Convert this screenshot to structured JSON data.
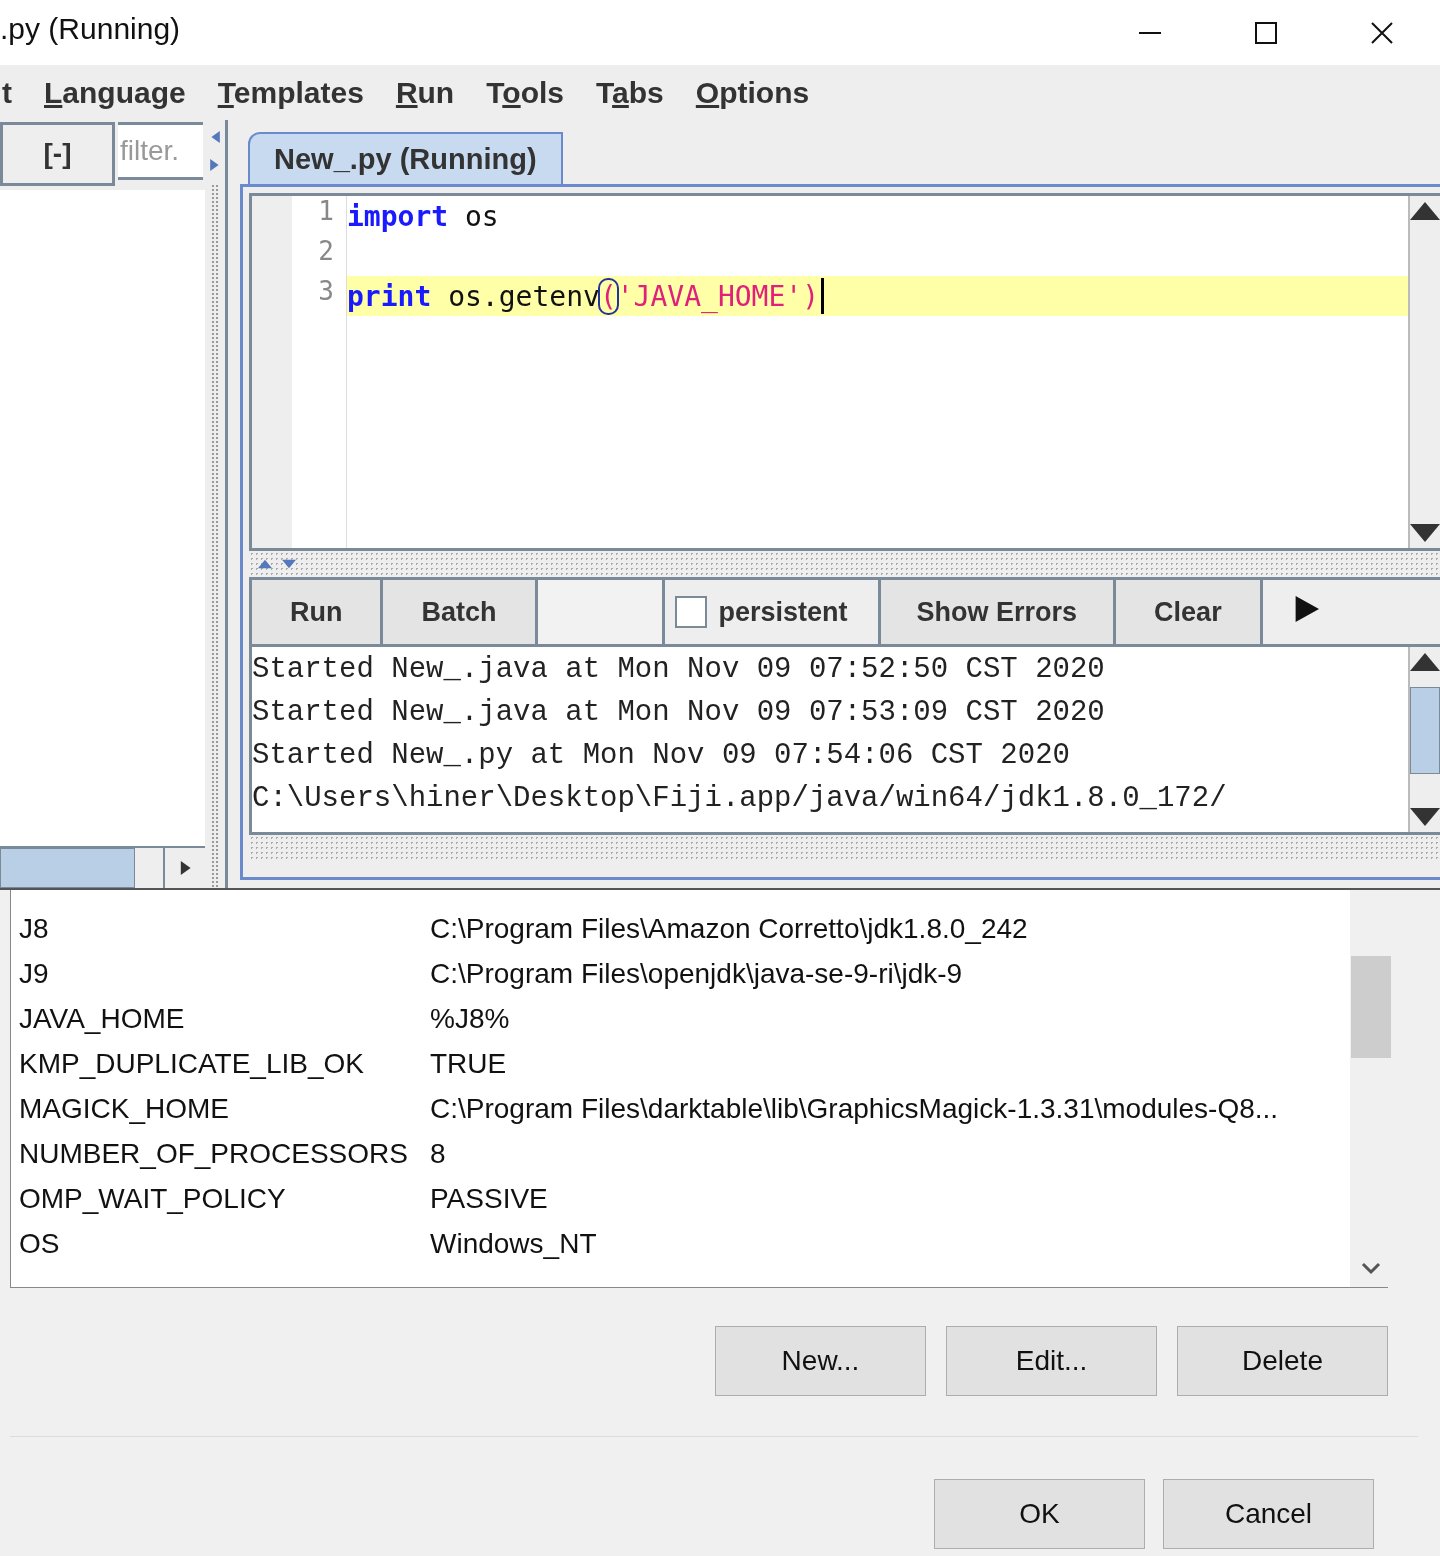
{
  "window": {
    "title": ".py (Running)"
  },
  "menu": [
    {
      "pre": "t"
    },
    {
      "key": "L",
      "post": "anguage"
    },
    {
      "key": "T",
      "post": "emplates"
    },
    {
      "key": "R",
      "post": "un"
    },
    {
      "pre": "T",
      "key": "o",
      "post": "ols"
    },
    {
      "pre": "T",
      "key": "a",
      "post": "bs"
    },
    {
      "key": "O",
      "post": "ptions"
    }
  ],
  "sidebar": {
    "collapse_button": "[-]",
    "filter": {
      "placeholder": "filter."
    }
  },
  "editor": {
    "tab": {
      "label": "New_.py (Running)",
      "selected": true
    },
    "lines": [
      {
        "number": "1",
        "current": false,
        "tokens": [
          {
            "text": "import",
            "kind": "keyword"
          },
          {
            "text": " os",
            "kind": "plain"
          }
        ]
      },
      {
        "number": "2",
        "current": false
      },
      {
        "number": "3",
        "current": true,
        "tokens": [
          {
            "text": "print",
            "kind": "keyword"
          },
          {
            "text": " os.getenv",
            "kind": "plain"
          },
          {
            "text": "(",
            "kind": "match"
          },
          {
            "text": "'JAVA_HOME'",
            "kind": "string"
          },
          {
            "text": ")",
            "kind": "paren"
          }
        ]
      }
    ]
  },
  "run_bar": [
    {
      "kind": "button",
      "label": "Run",
      "disabled": false
    },
    {
      "kind": "button",
      "label": "Batch",
      "disabled": false
    },
    {
      "kind": "button",
      "disabled": true
    },
    {
      "kind": "checkbox",
      "label": "persistent",
      "checked": false
    },
    {
      "kind": "button",
      "label": "Show Errors",
      "disabled": false
    },
    {
      "kind": "button",
      "label": "Clear",
      "disabled": false
    },
    {
      "kind": "arrow"
    }
  ],
  "output": [
    "Started New_.java at Mon Nov 09 07:52:50 CST 2020",
    "Started New_.java at Mon Nov 09 07:53:09 CST 2020",
    "Started New_.py at Mon Nov 09 07:54:06 CST 2020",
    "C:\\Users\\hiner\\Desktop\\Fiji.app/java/win64/jdk1.8.0_172/"
  ],
  "table": {
    "rows": [
      [
        "J8",
        "C:\\Program Files\\Amazon Corretto\\jdk1.8.0_242"
      ],
      [
        "J9",
        "C:\\Program Files\\openjdk\\java-se-9-ri\\jdk-9"
      ],
      [
        "JAVA_HOME",
        "%J8%"
      ],
      [
        "KMP_DUPLICATE_LIB_OK",
        "TRUE"
      ],
      [
        "MAGICK_HOME",
        "C:\\Program Files\\darktable\\lib\\GraphicsMagick-1.3.31\\modules-Q8..."
      ],
      [
        "NUMBER_OF_PROCESSORS",
        "8"
      ],
      [
        "OMP_WAIT_POLICY",
        "PASSIVE"
      ],
      [
        "OS",
        "Windows_NT"
      ]
    ]
  },
  "table_buttons": [
    "New...",
    "Edit...",
    "Delete"
  ],
  "dialog_buttons": [
    "OK",
    "Cancel"
  ]
}
